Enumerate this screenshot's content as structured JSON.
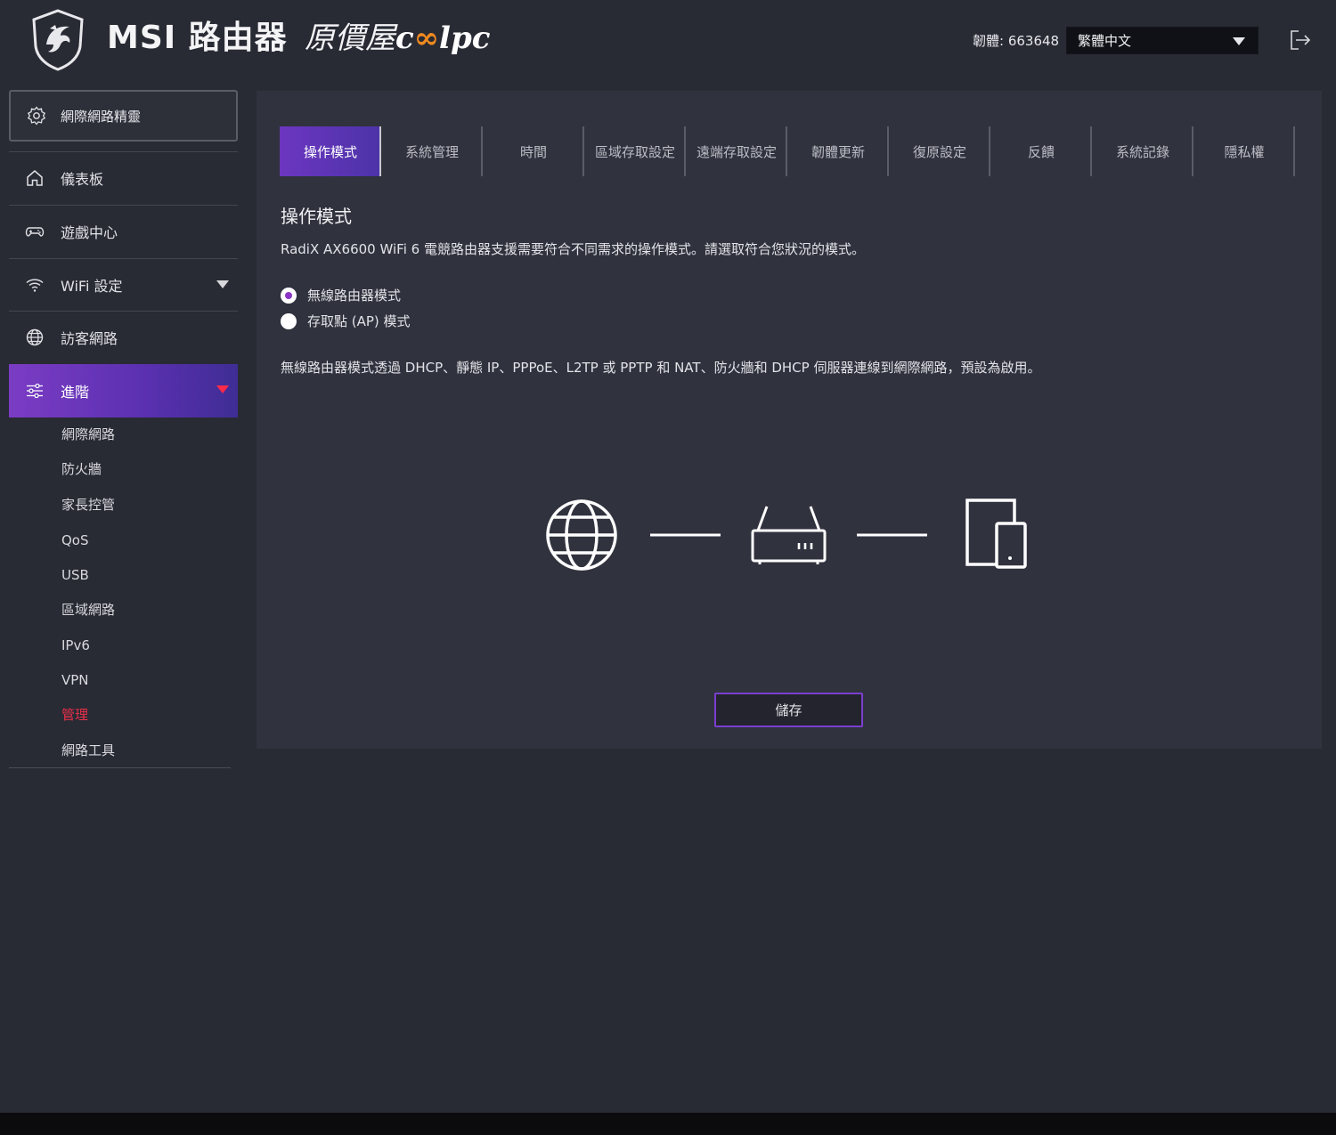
{
  "header": {
    "brand": "MSI 路由器",
    "coolpc_prefix": "原價屋",
    "coolpc_c": "c",
    "coolpc_oo": "∞",
    "coolpc_lpc": "lpc",
    "firmware": "韌體: 663648",
    "language": "繁體中文"
  },
  "sidebar": {
    "wizard": "網際網路精靈",
    "items": [
      {
        "label": "儀表板",
        "icon": "home-icon"
      },
      {
        "label": "遊戲中心",
        "icon": "gamepad-icon"
      },
      {
        "label": "WiFi 設定",
        "icon": "wifi-icon"
      },
      {
        "label": "訪客網路",
        "icon": "globe-icon"
      },
      {
        "label": "進階",
        "icon": "sliders-icon"
      }
    ],
    "sub_items": [
      "網際網路",
      "防火牆",
      "家長控管",
      "QoS",
      "USB",
      "區域網路",
      "IPv6",
      "VPN",
      "管理",
      "網路工具"
    ]
  },
  "tabs": [
    "操作模式",
    "系統管理",
    "時間",
    "區域存取設定",
    "遠端存取設定",
    "韌體更新",
    "復原設定",
    "反饋",
    "系統記錄",
    "隱私權"
  ],
  "content": {
    "title": "操作模式",
    "description": "RadiX AX6600 WiFi 6 電競路由器支援需要符合不同需求的操作模式。請選取符合您狀況的模式。",
    "options": [
      {
        "label": "無線路由器模式",
        "checked": true
      },
      {
        "label": "存取點 (AP) 模式",
        "checked": false
      }
    ],
    "mode_description": "無線路由器模式透過 DHCP、靜態 IP、PPPoE、L2TP 或 PPTP 和 NAT、防火牆和 DHCP 伺服器連線到網際網路，預設為啟用。",
    "save": "儲存"
  },
  "colors": {
    "accent": "#7b3cc4",
    "active_red": "#e8304a",
    "background": "#282a34",
    "panel": "#30323e"
  }
}
